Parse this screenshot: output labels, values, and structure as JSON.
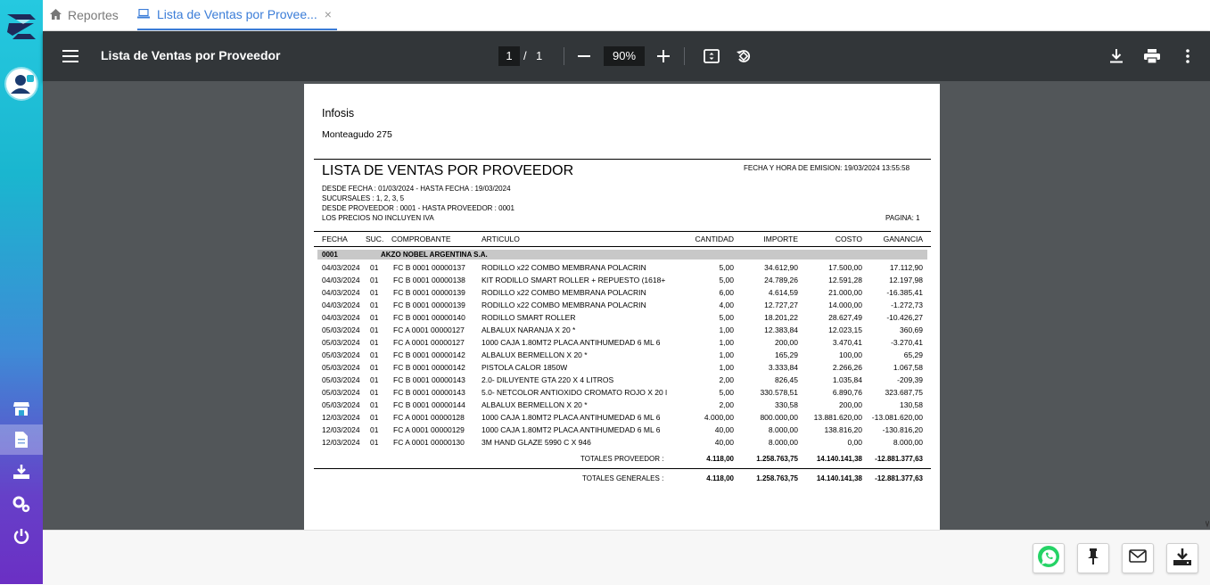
{
  "app": {
    "colors": {
      "accent": "#3b7dd8",
      "toolbar": "#323639",
      "viewer_bg": "#525659"
    }
  },
  "tabs": [
    {
      "label": "Reportes",
      "icon": "home-icon"
    },
    {
      "label": "Lista de Ventas por Provee...",
      "icon": "laptop-icon"
    }
  ],
  "sidebar": {
    "items": [
      "store-icon",
      "document-icon",
      "download-tray-icon",
      "settings-icon",
      "power-icon"
    ]
  },
  "toolbar": {
    "title": "Lista de Ventas por Proveedor",
    "page_current": "1",
    "page_separator": "/",
    "page_total": "1",
    "zoom": "90%"
  },
  "report": {
    "company": "Infosis",
    "address": "Monteagudo 275",
    "title": "LISTA DE VENTAS POR PROVEEDOR",
    "emission": "FECHA Y HORA DE EMISION: 19/03/2024 13:55:58",
    "filters": [
      "DESDE FECHA : 01/03/2024 - HASTA FECHA : 19/03/2024",
      "SUCURSALES : 1, 2, 3, 5",
      "DESDE PROVEEDOR : 0001 - HASTA PROVEEDOR : 0001",
      "LOS PRECIOS NO INCLUYEN IVA"
    ],
    "page_label": "PAGINA: 1",
    "columns": [
      "FECHA",
      "SUC.",
      "COMPROBANTE",
      "ARTICULO",
      "CANTIDAD",
      "IMPORTE",
      "COSTO",
      "GANANCIA"
    ],
    "supplier_code": "0001",
    "supplier_name": "AKZO NOBEL ARGENTINA S.A.",
    "rows": [
      [
        "04/03/2024",
        "01",
        "FC  B  0001 00000137",
        "RODILLO x22 COMBO MEMBRANA POLACRIN",
        "5,00",
        "34.612,90",
        "17.500,00",
        "17.112,90"
      ],
      [
        "04/03/2024",
        "01",
        "FC  B  0001 00000138",
        "KIT RODILLO SMART ROLLER + REPUESTO (1618+",
        "5,00",
        "24.789,26",
        "12.591,28",
        "12.197,98"
      ],
      [
        "04/03/2024",
        "01",
        "FC  B  0001 00000139",
        "RODILLO x22 COMBO MEMBRANA POLACRIN",
        "6,00",
        "4.614,59",
        "21.000,00",
        "-16.385,41"
      ],
      [
        "04/03/2024",
        "01",
        "FC  B  0001 00000139",
        "RODILLO x22 COMBO MEMBRANA POLACRIN",
        "4,00",
        "12.727,27",
        "14.000,00",
        "-1.272,73"
      ],
      [
        "04/03/2024",
        "01",
        "FC  B  0001 00000140",
        "RODILLO SMART ROLLER",
        "5,00",
        "18.201,22",
        "28.627,49",
        "-10.426,27"
      ],
      [
        "05/03/2024",
        "01",
        "FC  A  0001 00000127",
        "ALBALUX NARANJA X 20  *",
        "1,00",
        "12.383,84",
        "12.023,15",
        "360,69"
      ],
      [
        "05/03/2024",
        "01",
        "FC  A  0001 00000127",
        "1000  CAJA 1.80MT2  PLACA ANTIHUMEDAD 6 ML  6",
        "1,00",
        "200,00",
        "3.470,41",
        "-3.270,41"
      ],
      [
        "05/03/2024",
        "01",
        "FC  B  0001 00000142",
        "ALBALUX BERMELLON X 20  *",
        "1,00",
        "165,29",
        "100,00",
        "65,29"
      ],
      [
        "05/03/2024",
        "01",
        "FC  B  0001 00000142",
        "PISTOLA CALOR 1850W",
        "1,00",
        "3.333,84",
        "2.266,26",
        "1.067,58"
      ],
      [
        "05/03/2024",
        "01",
        "FC  B  0001 00000143",
        "2.0- DILUYENTE GTA 220 X 4 LITROS",
        "2,00",
        "826,45",
        "1.035,84",
        "-209,39"
      ],
      [
        "05/03/2024",
        "01",
        "FC  B  0001 00000143",
        "5.0- NETCOLOR ANTIOXIDO CROMATO ROJO X 20 l",
        "5,00",
        "330.578,51",
        "6.890,76",
        "323.687,75"
      ],
      [
        "05/03/2024",
        "01",
        "FC  B  0001 00000144",
        "ALBALUX BERMELLON X 20  *",
        "2,00",
        "330,58",
        "200,00",
        "130,58"
      ],
      [
        "12/03/2024",
        "01",
        "FC  A  0001 00000128",
        "1000  CAJA 1.80MT2  PLACA ANTIHUMEDAD 6 ML  6",
        "4.000,00",
        "800.000,00",
        "13.881.620,00",
        "-13.081.620,00"
      ],
      [
        "12/03/2024",
        "01",
        "FC  A  0001 00000129",
        "1000  CAJA 1.80MT2  PLACA ANTIHUMEDAD 6 ML  6",
        "40,00",
        "8.000,00",
        "138.816,20",
        "-130.816,20"
      ],
      [
        "12/03/2024",
        "01",
        "FC  A  0001 00000130",
        "3M HAND GLAZE 5990 C X 946",
        "40,00",
        "8.000,00",
        "0,00",
        "8.000,00"
      ]
    ],
    "totals_supplier": {
      "label": "TOTALES PROVEEDOR :",
      "cantidad": "4.118,00",
      "importe": "1.258.763,75",
      "costo": "14.140.141,38",
      "ganancia": "-12.881.377,63"
    },
    "totals_general": {
      "label": "TOTALES GENERALES :",
      "cantidad": "4.118,00",
      "importe": "1.258.763,75",
      "costo": "14.140.141,38",
      "ganancia": "-12.881.377,63"
    }
  },
  "footer": {
    "buttons": [
      "whatsapp-icon",
      "pin-icon",
      "mail-icon",
      "download-icon"
    ]
  }
}
